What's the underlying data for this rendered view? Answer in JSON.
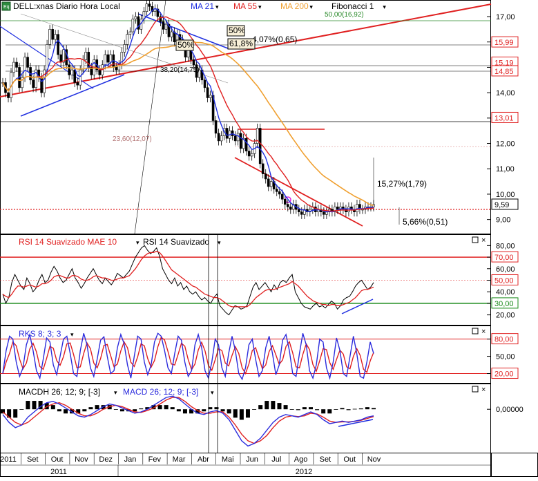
{
  "colors": {
    "background": "#ffffff",
    "grid": "#000000",
    "price": "#000000",
    "ma21": "#1f2fe0",
    "ma55": "#e02020",
    "ma200": "#f0a030",
    "fib": "#2a8a2a",
    "rsi": "#000000",
    "rsi_mae": "#e02020",
    "stoch_k": "#2b2bdd",
    "stoch_d": "#e02020",
    "macd": "#2b2bdd",
    "macd_signal": "#e02020",
    "histogram": "#000000",
    "level_red": "#e02020",
    "level_green": "#1a8a1a",
    "trendline": "#e02020",
    "trendline_blue": "#1f2fe0",
    "label_box_fill": "#f8f0d8"
  },
  "chart_data": [
    {
      "id": "price",
      "type": "line",
      "title": "DELL:xnas Diario Hora Local",
      "legend": [
        {
          "label": "MA 21",
          "color": "#1f2fe0"
        },
        {
          "label": "MA 55",
          "color": "#e02020"
        },
        {
          "label": "MA 200",
          "color": "#f0a030"
        },
        {
          "label": "Fibonacci 1",
          "color": "#000000"
        }
      ],
      "ylim": [
        8.5,
        17.6
      ],
      "y_ticks": [
        "9,00",
        "10,00",
        "11,00",
        "12,00",
        "13,00",
        "14,00",
        "15,00",
        "16,00",
        "17,00"
      ],
      "price_labels": [
        {
          "value": 15.99,
          "text": "15,99",
          "color": "#e02020"
        },
        {
          "value": 15.19,
          "text": "15,19",
          "color": "#e02020"
        },
        {
          "value": 14.85,
          "text": "14,85",
          "color": "#e02020"
        },
        {
          "value": 13.01,
          "text": "13,01",
          "color": "#e02020"
        },
        {
          "value": 9.59,
          "text": "9,59",
          "color": "#000000"
        }
      ],
      "annotations": [
        {
          "text": "50%",
          "boxed": true
        },
        {
          "text": "4,07%(0,65)"
        },
        {
          "text": "50%",
          "boxed": true
        },
        {
          "text": "61,8%",
          "boxed": true
        },
        {
          "text": "38,20(14,75)"
        },
        {
          "text": "23,60(12,07)"
        },
        {
          "text": "50,00(16,92)"
        },
        {
          "text": "15,27%(1,79)"
        },
        {
          "text": "5,66%(0,51)"
        }
      ],
      "series": [
        {
          "name": "DELL",
          "x": [
            0,
            4,
            8,
            12,
            16,
            20,
            24,
            28,
            32,
            36,
            40,
            44,
            48,
            52,
            56,
            60,
            64,
            68,
            72,
            76,
            80,
            84,
            88,
            92,
            96,
            100,
            104,
            108,
            112,
            116,
            120,
            124,
            128,
            132,
            136,
            140,
            144,
            148,
            152,
            156,
            160,
            164,
            168,
            172,
            176,
            180,
            184,
            188,
            192,
            196,
            200,
            204,
            208,
            212,
            216,
            220,
            224,
            228,
            232,
            236,
            240,
            244,
            248,
            252,
            256,
            260,
            264,
            268,
            272,
            276,
            280,
            284,
            288,
            292,
            296,
            300,
            304,
            308,
            312,
            316,
            320,
            324,
            328,
            332,
            336,
            340,
            344,
            348,
            352,
            356,
            360,
            364,
            368,
            372,
            376,
            380,
            384,
            388,
            392,
            396,
            400,
            404,
            408,
            412,
            416,
            420,
            424,
            428,
            432,
            436,
            440,
            444,
            448,
            452,
            456,
            460,
            464,
            468,
            472,
            476,
            480,
            484,
            488,
            492,
            496,
            500,
            504,
            508,
            512,
            516,
            520,
            524,
            528,
            532,
            536
          ],
          "values": [
            14.4,
            14.0,
            13.8,
            14.8,
            15.2,
            15.0,
            14.2,
            14.6,
            15.4,
            15.0,
            14.5,
            14.2,
            14.9,
            14.6,
            14.0,
            14.9,
            15.9,
            16.5,
            16.1,
            16.3,
            15.5,
            15.2,
            15.7,
            15.1,
            14.7,
            14.9,
            14.4,
            14.3,
            14.9,
            15.3,
            15.6,
            15.0,
            14.7,
            15.3,
            14.9,
            14.7,
            15.1,
            15.5,
            15.2,
            15.5,
            15.0,
            14.9,
            15.1,
            15.6,
            15.9,
            16.3,
            16.4,
            16.9,
            17.0,
            16.5,
            16.9,
            17.2,
            17.5,
            17.4,
            17.2,
            17.3,
            17.0,
            16.8,
            16.5,
            16.7,
            16.2,
            16.4,
            16.0,
            16.3,
            16.1,
            15.9,
            15.4,
            15.8,
            15.3,
            15.1,
            14.6,
            14.9,
            14.5,
            14.2,
            13.8,
            13.9,
            12.9,
            12.4,
            12.1,
            12.3,
            12.6,
            12.2,
            12.5,
            12.3,
            12.1,
            12.4,
            11.8,
            12.2,
            11.7,
            11.5,
            11.6,
            12.0,
            12.6,
            11.2,
            10.8,
            10.6,
            10.3,
            10.5,
            10.2,
            10.1,
            10.0,
            9.8,
            9.6,
            9.5,
            9.4,
            9.6,
            9.4,
            9.3,
            9.2,
            9.4,
            9.3,
            9.4,
            9.5,
            9.3,
            9.4,
            9.3,
            9.2,
            9.3,
            9.4,
            9.3,
            9.5,
            9.4,
            9.5,
            9.4,
            9.3,
            9.5,
            9.4,
            9.3,
            9.6,
            9.4,
            9.4,
            9.5,
            9.5,
            9.5,
            9.59
          ]
        }
      ]
    },
    {
      "id": "rsi",
      "type": "line",
      "legend": [
        {
          "label": "RSI 14 Suavizado MAE 10",
          "color": "#e02020"
        },
        {
          "label": "RSI 14 Suavizado",
          "color": "#000000"
        }
      ],
      "ylim": [
        12,
        88
      ],
      "y_ticks": [
        "20,00",
        "30,00",
        "40,00",
        "50,00",
        "60,00",
        "70,00",
        "80,00"
      ],
      "levels": [
        {
          "value": 70,
          "text": "70,00",
          "color": "#e02020"
        },
        {
          "value": 50,
          "text": "50,00",
          "color": "#e02020"
        },
        {
          "value": 30,
          "text": "30,00",
          "color": "#1a8a1a"
        }
      ],
      "series": [
        {
          "name": "RSI 14 Suavizado",
          "values": [
            38,
            30,
            35,
            48,
            55,
            50,
            45,
            42,
            52,
            47,
            40,
            43,
            50,
            55,
            48,
            50,
            57,
            62,
            58,
            52,
            48,
            50,
            55,
            60,
            52,
            48,
            43,
            47,
            52,
            56,
            60,
            55,
            50,
            47,
            52,
            49,
            46,
            50,
            56,
            54,
            52,
            55,
            58,
            64,
            70,
            74,
            78,
            80,
            76,
            73,
            75,
            78,
            71,
            60,
            55,
            50,
            47,
            52,
            45,
            48,
            42,
            45,
            40,
            38,
            40,
            36,
            33,
            35,
            32,
            30,
            35,
            38,
            28,
            25,
            22,
            20,
            24,
            28,
            27,
            25,
            26,
            28,
            36,
            44,
            48,
            42,
            45,
            48,
            44,
            40,
            46,
            42,
            48,
            50,
            48,
            52,
            55,
            40,
            35,
            30,
            27,
            26,
            25,
            28,
            30,
            27,
            28,
            26,
            29,
            32,
            30,
            25,
            28,
            33,
            35,
            36,
            40,
            45,
            48,
            50,
            46,
            42,
            44,
            48
          ]
        },
        {
          "name": "RSI 14 Suavizado MAE 10",
          "values": [
            38,
            36,
            35,
            38,
            42,
            45,
            45,
            44,
            45,
            46,
            45,
            44,
            45,
            47,
            47,
            48,
            50,
            53,
            54,
            54,
            53,
            52,
            52,
            54,
            54,
            53,
            51,
            50,
            50,
            51,
            53,
            54,
            53,
            52,
            52,
            51,
            50,
            50,
            51,
            52,
            52,
            53,
            54,
            57,
            60,
            64,
            68,
            71,
            73,
            74,
            74,
            75,
            74,
            71,
            67,
            63,
            59,
            57,
            55,
            53,
            51,
            49,
            47,
            45,
            44,
            42,
            40,
            38,
            37,
            36,
            35,
            35,
            34,
            32,
            30,
            28,
            27,
            27,
            27,
            27,
            27,
            27,
            29,
            32,
            35,
            37,
            39,
            41,
            42,
            42,
            42,
            43,
            44,
            45,
            46,
            47,
            49,
            47,
            45,
            42,
            39,
            36,
            34,
            32,
            31,
            30,
            29,
            29,
            28,
            29,
            29,
            28,
            28,
            29,
            30,
            31,
            33,
            35,
            38,
            41,
            42,
            42,
            43,
            44
          ]
        }
      ]
    },
    {
      "id": "stochastic",
      "type": "line",
      "legend": [
        {
          "label": "RKS 8; 3; 3",
          "color": "#2b2bdd"
        }
      ],
      "ylim": [
        5,
        100
      ],
      "y_ticks": [
        "20,00",
        "50,00",
        "80,00"
      ],
      "levels": [
        {
          "value": 80,
          "text": "80,00",
          "color": "#e02020"
        },
        {
          "value": 20,
          "text": "20,00",
          "color": "#e02020"
        }
      ],
      "series": [
        {
          "name": "RKS 8; 3; 3",
          "values": [
            20,
            60,
            85,
            80,
            40,
            15,
            30,
            70,
            88,
            60,
            25,
            12,
            45,
            82,
            75,
            35,
            18,
            50,
            80,
            85,
            55,
            20,
            15,
            60,
            90,
            70,
            30,
            15,
            45,
            78,
            84,
            50,
            20,
            25,
            65,
            88,
            72,
            35,
            12,
            50,
            85,
            80,
            40,
            18,
            35,
            75,
            90,
            85,
            60,
            30,
            20,
            55,
            85,
            78,
            40,
            15,
            25,
            70,
            88,
            65,
            25,
            12,
            40,
            80,
            70,
            30,
            15,
            55,
            85,
            60,
            20,
            10,
            30,
            70,
            80,
            45,
            15,
            25,
            65,
            85,
            55,
            18,
            35,
            78,
            88,
            60,
            20,
            15,
            55,
            90,
            70,
            25,
            12,
            35,
            80,
            75,
            30,
            12,
            40,
            82,
            60,
            20,
            15,
            50,
            85,
            55,
            15,
            12,
            40,
            75,
            55
          ]
        }
      ]
    },
    {
      "id": "macd",
      "type": "line",
      "legend": [
        {
          "label": "MACDH 26; 12; 9; [-3]",
          "color": "#000000"
        },
        {
          "label": "MACD 26; 12; 9; [-3]",
          "color": "#2b2bdd"
        }
      ],
      "ylim": [
        -1.6,
        0.9
      ],
      "y_ticks": [
        "0,00000"
      ],
      "series": [
        {
          "name": "MACD 26; 12; 9; [-3]",
          "values": [
            -0.2,
            -0.5,
            -0.7,
            -0.6,
            -0.3,
            -0.1,
            0.1,
            0.25,
            0.3,
            0.2,
            0.05,
            -0.1,
            -0.25,
            -0.3,
            -0.2,
            -0.05,
            0.1,
            0.2,
            0.15,
            0.05,
            -0.05,
            -0.15,
            -0.1,
            0.0,
            0.15,
            0.3,
            0.45,
            0.5,
            0.4,
            0.2,
            0.0,
            -0.15,
            -0.2,
            -0.1,
            -0.05,
            -0.15,
            -0.4,
            -0.8,
            -1.2,
            -1.4,
            -1.3,
            -1.1,
            -0.8,
            -0.5,
            -0.3,
            -0.2,
            -0.25,
            -0.3,
            -0.2,
            -0.1,
            -0.2,
            -0.4,
            -0.55,
            -0.5,
            -0.45,
            -0.5,
            -0.45,
            -0.4,
            -0.3,
            -0.25
          ]
        },
        {
          "name": "Signal",
          "values": [
            -0.1,
            -0.3,
            -0.5,
            -0.6,
            -0.5,
            -0.3,
            -0.1,
            0.1,
            0.2,
            0.25,
            0.15,
            0.0,
            -0.15,
            -0.25,
            -0.25,
            -0.15,
            0.0,
            0.1,
            0.15,
            0.1,
            0.0,
            -0.1,
            -0.12,
            -0.05,
            0.05,
            0.2,
            0.35,
            0.45,
            0.45,
            0.3,
            0.1,
            -0.05,
            -0.15,
            -0.15,
            -0.1,
            -0.1,
            -0.3,
            -0.6,
            -0.95,
            -1.2,
            -1.3,
            -1.2,
            -1.0,
            -0.7,
            -0.45,
            -0.3,
            -0.25,
            -0.28,
            -0.25,
            -0.15,
            -0.18,
            -0.3,
            -0.45,
            -0.5,
            -0.48,
            -0.48,
            -0.46,
            -0.42,
            -0.35,
            -0.28
          ]
        }
      ]
    }
  ],
  "x_axis": {
    "months": [
      "2011",
      "Set",
      "Out",
      "Nov",
      "Dez",
      "Jan",
      "Fev",
      "Mar",
      "Abr",
      "Mai",
      "Jun",
      "Jul",
      "Ago",
      "Set",
      "Out",
      "Nov"
    ],
    "years": [
      "2011",
      "2012"
    ]
  }
}
